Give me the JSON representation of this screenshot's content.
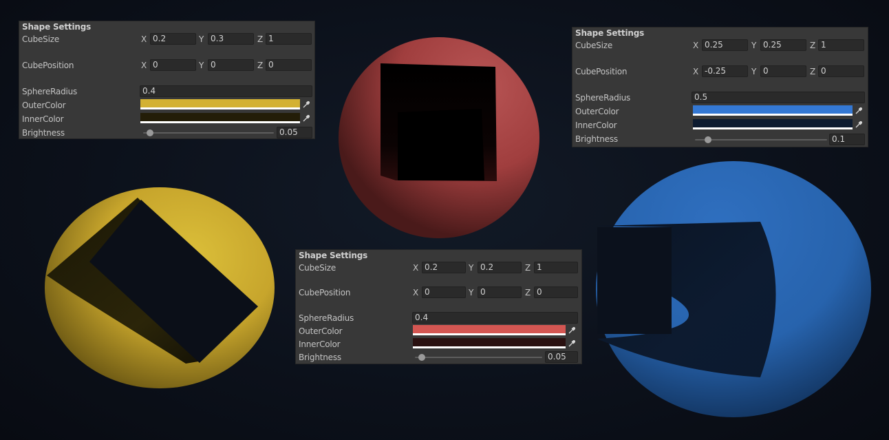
{
  "panels": {
    "yellow": {
      "title": "Shape Settings",
      "cube_size": {
        "label": "CubeSize",
        "x": "0.2",
        "y": "0.3",
        "z": "1"
      },
      "cube_position": {
        "label": "CubePosition",
        "x": "0",
        "y": "0",
        "z": "0"
      },
      "sphere_radius": {
        "label": "SphereRadius",
        "value": "0.4"
      },
      "outer_color": {
        "label": "OuterColor",
        "color": "#d3b132"
      },
      "inner_color": {
        "label": "InnerColor",
        "color": "#231d08"
      },
      "brightness": {
        "label": "Brightness",
        "value": "0.05",
        "fraction": 0.05
      }
    },
    "blue": {
      "title": "Shape Settings",
      "cube_size": {
        "label": "CubeSize",
        "x": "0.25",
        "y": "0.25",
        "z": "1"
      },
      "cube_position": {
        "label": "CubePosition",
        "x": "-0.25",
        "y": "0",
        "z": "0"
      },
      "sphere_radius": {
        "label": "SphereRadius",
        "value": "0.5"
      },
      "outer_color": {
        "label": "OuterColor",
        "color": "#3478d4"
      },
      "inner_color": {
        "label": "InnerColor",
        "color": "#0d1b30"
      },
      "brightness": {
        "label": "Brightness",
        "value": "0.1",
        "fraction": 0.1
      }
    },
    "red": {
      "title": "Shape Settings",
      "cube_size": {
        "label": "CubeSize",
        "x": "0.2",
        "y": "0.2",
        "z": "1"
      },
      "cube_position": {
        "label": "CubePosition",
        "x": "0",
        "y": "0",
        "z": "0"
      },
      "sphere_radius": {
        "label": "SphereRadius",
        "value": "0.4"
      },
      "outer_color": {
        "label": "OuterColor",
        "color": "#d45652"
      },
      "inner_color": {
        "label": "InnerColor",
        "color": "#2a1111"
      },
      "brightness": {
        "label": "Brightness",
        "value": "0.05",
        "fraction": 0.05
      }
    }
  },
  "axis_labels": {
    "x": "X",
    "y": "Y",
    "z": "Z"
  },
  "icons": {
    "color_picker": "eyedropper-icon"
  },
  "colors": {
    "background": "#0c111b",
    "panel_bg": "#383838",
    "field_bg": "#2a2a2a",
    "yellow_sphere": "#d3b132",
    "red_sphere": "#c24e4e",
    "blue_sphere": "#2e6cb8"
  }
}
